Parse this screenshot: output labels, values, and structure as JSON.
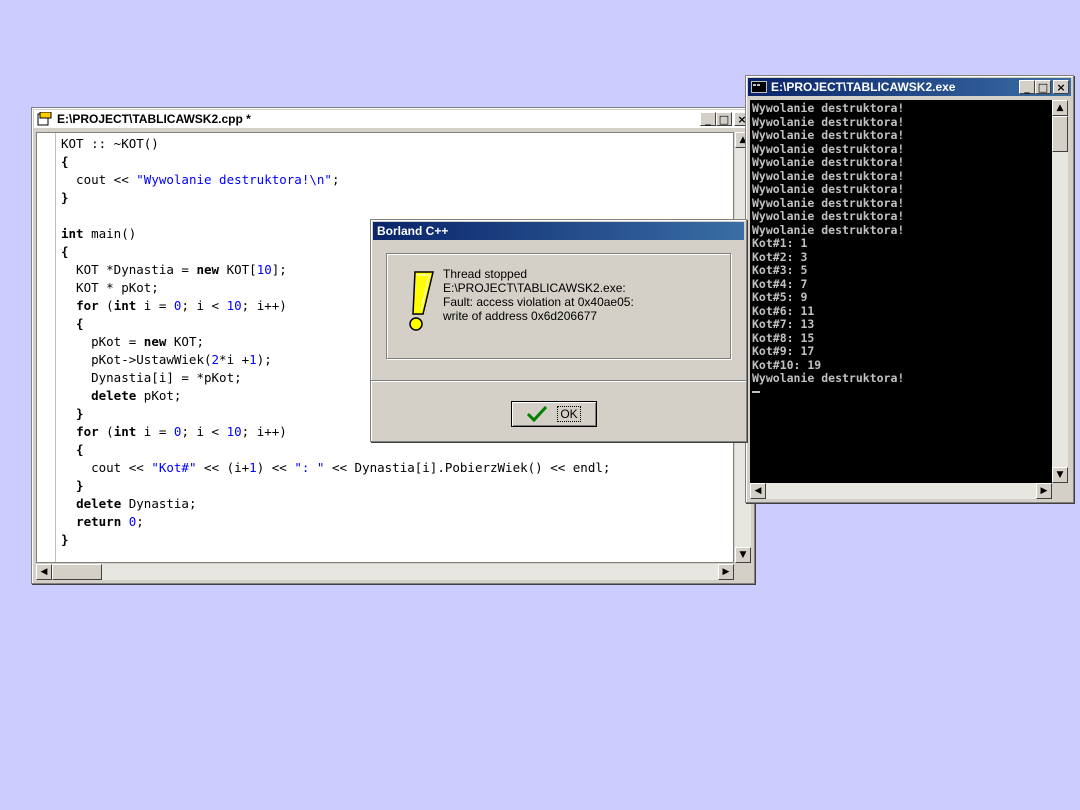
{
  "editor": {
    "title": "E:\\PROJECT\\TABLICAWSK2.cpp *",
    "code": [
      [
        {
          "t": "KOT :: ~KOT()"
        }
      ],
      [
        {
          "t": "{",
          "c": "kw"
        }
      ],
      [
        {
          "t": "  cout << "
        },
        {
          "t": "\"Wywolanie destruktora!\\n\"",
          "c": "str"
        },
        {
          "t": ";"
        }
      ],
      [
        {
          "t": "}",
          "c": "kw"
        }
      ],
      [
        {
          "t": ""
        }
      ],
      [
        {
          "t": "int",
          "c": "kw"
        },
        {
          "t": " main()"
        }
      ],
      [
        {
          "t": "{",
          "c": "kw"
        }
      ],
      [
        {
          "t": "  KOT *Dynastia = "
        },
        {
          "t": "new",
          "c": "kw"
        },
        {
          "t": " KOT["
        },
        {
          "t": "10",
          "c": "num"
        },
        {
          "t": "];"
        }
      ],
      [
        {
          "t": "  KOT * pKot;"
        }
      ],
      [
        {
          "t": "  "
        },
        {
          "t": "for",
          "c": "kw"
        },
        {
          "t": " ("
        },
        {
          "t": "int",
          "c": "kw"
        },
        {
          "t": " i = "
        },
        {
          "t": "0",
          "c": "num"
        },
        {
          "t": "; i < "
        },
        {
          "t": "10",
          "c": "num"
        },
        {
          "t": "; i++)"
        }
      ],
      [
        {
          "t": "  {",
          "c": "kw"
        }
      ],
      [
        {
          "t": "    pKot = "
        },
        {
          "t": "new",
          "c": "kw"
        },
        {
          "t": " KOT;"
        }
      ],
      [
        {
          "t": "    pKot->UstawWiek("
        },
        {
          "t": "2",
          "c": "num"
        },
        {
          "t": "*i +"
        },
        {
          "t": "1",
          "c": "num"
        },
        {
          "t": ");"
        }
      ],
      [
        {
          "t": "    Dynastia[i] = *pKot;"
        }
      ],
      [
        {
          "t": "    "
        },
        {
          "t": "delete",
          "c": "kw"
        },
        {
          "t": " pKot;"
        }
      ],
      [
        {
          "t": "  }",
          "c": "kw"
        }
      ],
      [
        {
          "t": "  "
        },
        {
          "t": "for",
          "c": "kw"
        },
        {
          "t": " ("
        },
        {
          "t": "int",
          "c": "kw"
        },
        {
          "t": " i = "
        },
        {
          "t": "0",
          "c": "num"
        },
        {
          "t": "; i < "
        },
        {
          "t": "10",
          "c": "num"
        },
        {
          "t": "; i++)"
        }
      ],
      [
        {
          "t": "  {",
          "c": "kw"
        }
      ],
      [
        {
          "t": "    cout << "
        },
        {
          "t": "\"Kot#\"",
          "c": "str"
        },
        {
          "t": " << (i+"
        },
        {
          "t": "1",
          "c": "num"
        },
        {
          "t": ") << "
        },
        {
          "t": "\": \"",
          "c": "str"
        },
        {
          "t": " << Dynastia[i].PobierzWiek() << endl;"
        }
      ],
      [
        {
          "t": "  }",
          "c": "kw"
        }
      ],
      [
        {
          "t": "  "
        },
        {
          "t": "delete",
          "c": "kw"
        },
        {
          "t": " Dynastia;"
        }
      ],
      [
        {
          "t": "  "
        },
        {
          "t": "return",
          "c": "kw"
        },
        {
          "t": " "
        },
        {
          "t": "0",
          "c": "num"
        },
        {
          "t": ";"
        }
      ],
      [
        {
          "t": "}",
          "c": "kw"
        }
      ]
    ]
  },
  "dialog": {
    "title": "Borland C++",
    "message": [
      "Thread stopped",
      "E:\\PROJECT\\TABLICAWSK2.exe:",
      "Fault: access violation at 0x40ae05:",
      "write of address 0x6d206677"
    ],
    "ok_label": "OK"
  },
  "console": {
    "title": "E:\\PROJECT\\TABLICAWSK2.exe",
    "lines": [
      "Wywolanie destruktora!",
      "Wywolanie destruktora!",
      "Wywolanie destruktora!",
      "Wywolanie destruktora!",
      "Wywolanie destruktora!",
      "Wywolanie destruktora!",
      "Wywolanie destruktora!",
      "Wywolanie destruktora!",
      "Wywolanie destruktora!",
      "Wywolanie destruktora!",
      "Kot#1: 1",
      "Kot#2: 3",
      "Kot#3: 5",
      "Kot#4: 7",
      "Kot#5: 9",
      "Kot#6: 11",
      "Kot#7: 13",
      "Kot#8: 15",
      "Kot#9: 17",
      "Kot#10: 19",
      "Wywolanie destruktora!"
    ]
  },
  "buttons": {
    "minimize": "_",
    "maximize": "□",
    "close": "×"
  }
}
